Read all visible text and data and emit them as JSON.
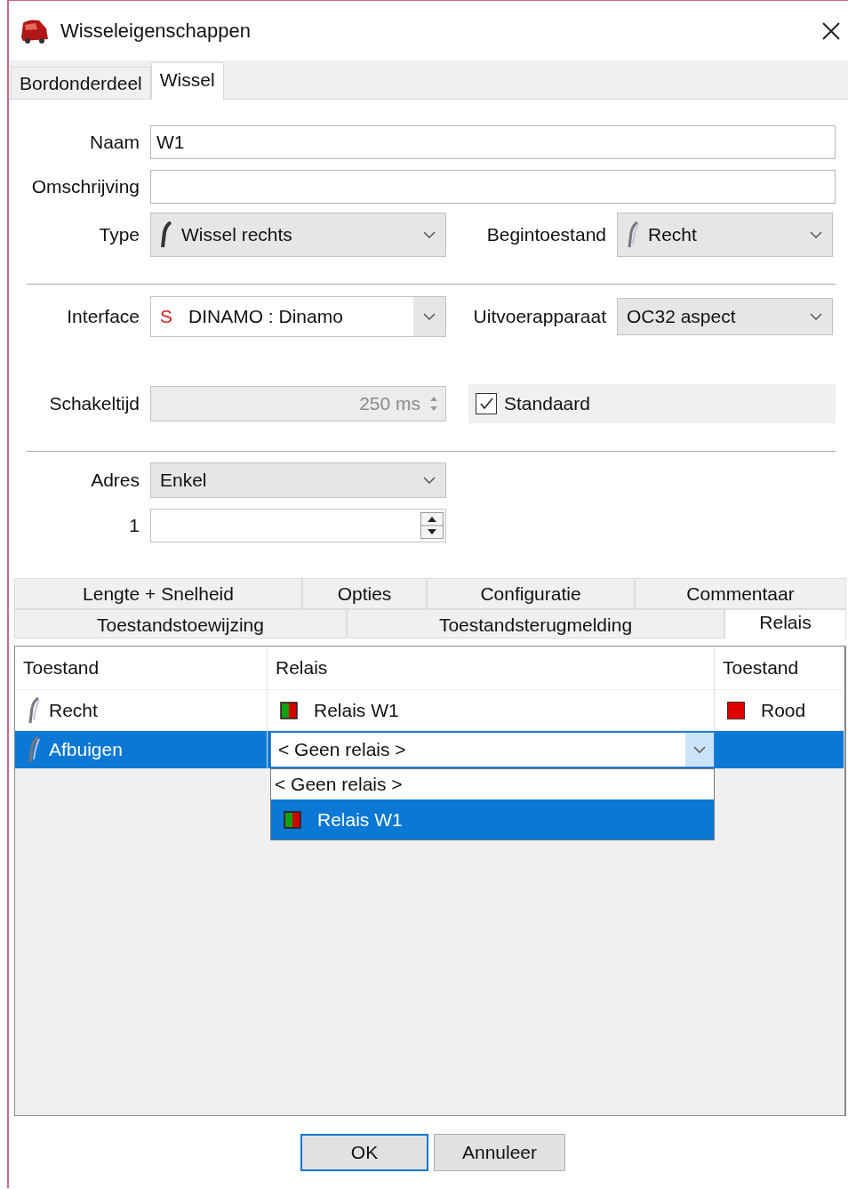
{
  "window": {
    "title": "Wisseleigenschappen"
  },
  "tabs": [
    {
      "label": "Bordonderdeel",
      "selected": false
    },
    {
      "label": "Wissel",
      "selected": true
    }
  ],
  "naam": {
    "label": "Naam",
    "value": "W1"
  },
  "omschrijving": {
    "label": "Omschrijving"
  },
  "type": {
    "label": "Type",
    "value": "Wissel rechts"
  },
  "begintoestand": {
    "label": "Begintoestand",
    "value": "Recht"
  },
  "interface": {
    "label": "Interface",
    "prefix": "S",
    "value": "DINAMO : Dinamo"
  },
  "uitvoerapparaat": {
    "label": "Uitvoerapparaat",
    "value": "OC32 aspect"
  },
  "schakeltijd": {
    "label": "Schakeltijd",
    "value": "250 ms",
    "disabled": true
  },
  "standaard": {
    "label": "Standaard",
    "checked": true
  },
  "adres": {
    "label": "Adres",
    "value": "Enkel"
  },
  "adres_nummer": {
    "label": "1"
  },
  "sub_tab_rows": [
    {
      "tabs": [
        {
          "label": "Lengte + Snelheid",
          "selected": false
        },
        {
          "label": "Opties",
          "selected": false
        },
        {
          "label": "Configuratie",
          "selected": false
        },
        {
          "label": "Commentaar",
          "selected": false
        }
      ]
    },
    {
      "tabs": [
        {
          "label": "Toestandstoewijzing",
          "selected": false
        },
        {
          "label": "Toestandsterugmelding",
          "selected": false
        },
        {
          "label": "Relais",
          "selected": true
        }
      ]
    }
  ],
  "relais_table": {
    "columns": [
      "Toestand",
      "Relais",
      "Toestand"
    ],
    "rows": [
      {
        "toestand": "Recht",
        "relais": "Relais W1",
        "relais_toestand": "Rood",
        "color": "#e00000",
        "selected": false,
        "editing": false
      },
      {
        "toestand": "Afbuigen",
        "relais": "< Geen relais >",
        "selected": true,
        "editing": true
      }
    ]
  },
  "dropdown": {
    "items": [
      {
        "label": "< Geen relais >",
        "kind": "plain",
        "selected": false
      },
      {
        "label": "Relais W1",
        "kind": "relay",
        "selected": true
      }
    ]
  },
  "buttons": [
    {
      "label": "OK",
      "default": true
    },
    {
      "label": "Annuleer",
      "default": false
    }
  ]
}
